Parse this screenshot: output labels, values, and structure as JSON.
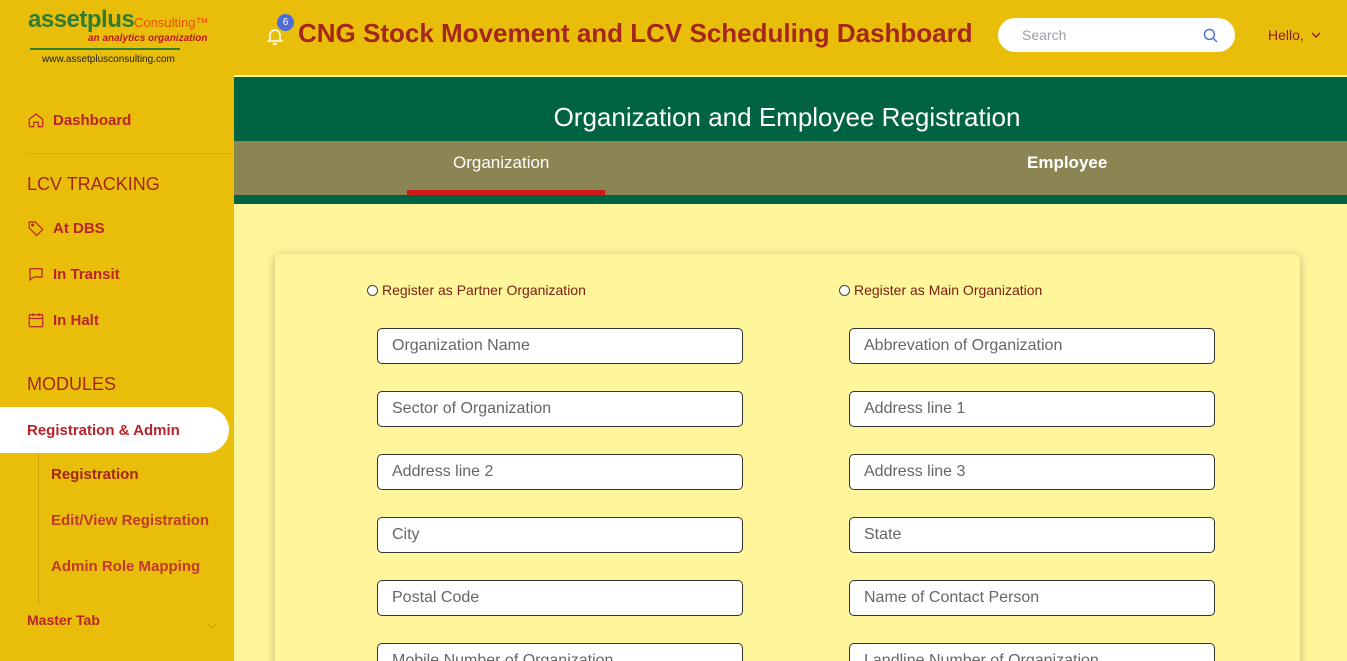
{
  "logo": {
    "brand": "assetplus",
    "consulting": "Consulting™",
    "tagline": "an analytics organization",
    "url": "www.assetplusconsulting.com"
  },
  "sidebar": {
    "dashboard": "Dashboard",
    "lcv_heading": "LCV TRACKING",
    "lcv_items": [
      "At DBS",
      "In Transit",
      "In Halt"
    ],
    "modules_heading": "MODULES",
    "active_item": "Registration & Admin",
    "sub_items": [
      "Registration",
      "Edit/View Registration",
      "Admin Role Mapping"
    ],
    "master_tab": "Master Tab"
  },
  "header": {
    "notification_count": "6",
    "title": "CNG Stock Movement and LCV Scheduling Dashboard",
    "search_placeholder": "Search",
    "greeting": "Hello,"
  },
  "banner": {
    "title": "Organization and Employee Registration",
    "tabs": [
      "Organization",
      "Employee"
    ]
  },
  "form": {
    "radio_partner": "Register as Partner Organization",
    "radio_main": "Register as Main Organization",
    "left_fields": [
      "Organization Name",
      "Sector of Organization",
      "Address line 2",
      "City",
      "Postal Code",
      "Mobile Number of Organization"
    ],
    "right_fields": [
      "Abbrevation of Organization",
      "Address line 1",
      "Address line 3",
      "State",
      "Name of Contact Person",
      "Landline Number of Organization"
    ]
  },
  "colors": {
    "sidebar_bg": "#E9BE0B",
    "banner_green": "#006341",
    "tab_bg": "#8A8552",
    "accent_red": "#B8232C",
    "page_bg": "#FFF59A"
  }
}
